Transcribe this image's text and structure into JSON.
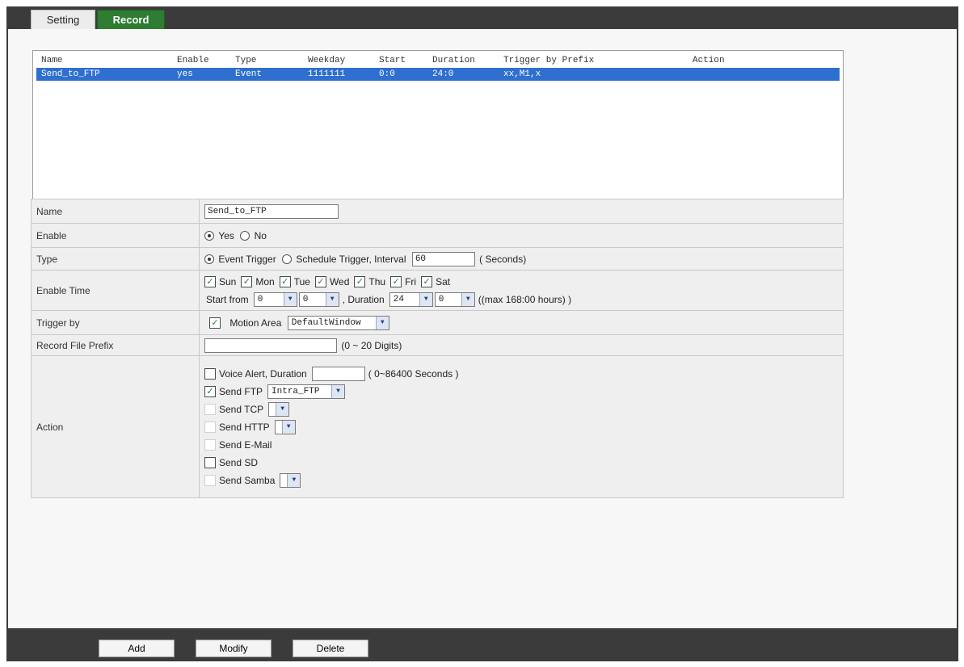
{
  "tabs": [
    {
      "label": "Setting",
      "active": false
    },
    {
      "label": "Record",
      "active": true
    }
  ],
  "list": {
    "columns": [
      "Name",
      "Enable",
      "Type",
      "Weekday",
      "Start",
      "Duration",
      "Trigger by Prefix",
      "Action"
    ],
    "rows": [
      {
        "name": "Send_to_FTP",
        "enable": "yes",
        "type": "Event",
        "weekday": "1111111",
        "start": "0:0",
        "duration": "24:0",
        "trigger": "xx,M1,x",
        "action": ""
      }
    ]
  },
  "form": {
    "name": {
      "label": "Name",
      "value": "Send_to_FTP"
    },
    "enable": {
      "label": "Enable",
      "yes": "Yes",
      "no": "No",
      "selected": "Yes"
    },
    "type": {
      "label": "Type",
      "event": "Event Trigger",
      "schedule": "Schedule Trigger, Interval",
      "interval": "60",
      "unit": "( Seconds)",
      "selected": "Event Trigger"
    },
    "enable_time": {
      "label": "Enable Time",
      "days": [
        "Sun",
        "Mon",
        "Tue",
        "Wed",
        "Thu",
        "Fri",
        "Sat"
      ],
      "start_label": "Start from",
      "start_hour": "0",
      "start_min": "0",
      "duration_label": ", Duration",
      "duration_hour": "24",
      "duration_min": "0",
      "max_note": "((max 168:00 hours) )"
    },
    "trigger_by": {
      "label": "Trigger by",
      "checkbox_label": "Motion Area",
      "select_value": "DefaultWindow"
    },
    "prefix": {
      "label": "Record File Prefix",
      "value": "",
      "note": "(0 ~ 20 Digits)"
    },
    "action": {
      "label": "Action",
      "voice_alert": {
        "label": "Voice Alert, Duration",
        "value": "",
        "note": "( 0~86400 Seconds )"
      },
      "send_ftp": {
        "label": "Send FTP",
        "select_value": "Intra_FTP"
      },
      "send_tcp": {
        "label": "Send TCP"
      },
      "send_http": {
        "label": "Send HTTP"
      },
      "send_email": {
        "label": "Send E-Mail"
      },
      "send_sd": {
        "label": "Send SD"
      },
      "send_samba": {
        "label": "Send Samba"
      }
    }
  },
  "buttons": {
    "add": "Add",
    "modify": "Modify",
    "delete": "Delete"
  },
  "colors": {
    "accent_green": "#2e7d32",
    "selection_blue": "#2f6fcf",
    "frame": "#3b3b3b"
  }
}
